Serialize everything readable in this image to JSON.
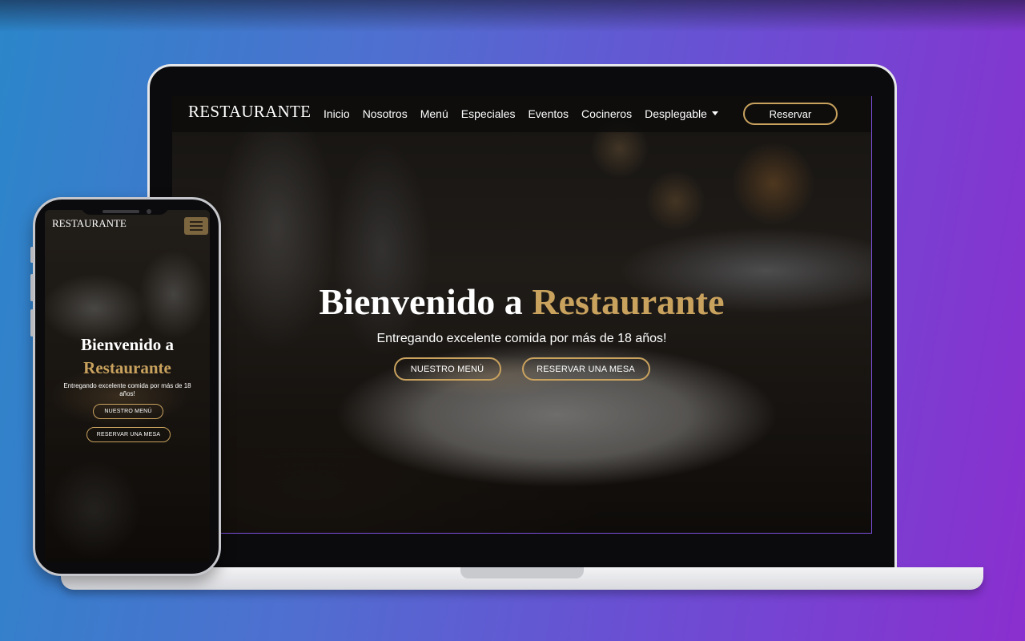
{
  "laptop": {
    "nav": {
      "brand": "RESTAURANTE",
      "links": [
        "Inicio",
        "Nosotros",
        "Menú",
        "Especiales",
        "Eventos",
        "Cocineros",
        "Desplegable"
      ],
      "cta": "Reservar"
    },
    "hero": {
      "title_prefix": "Bienvenido a ",
      "title_accent": "Restaurante",
      "subtitle": "Entregando excelente comida por más de 18 años!",
      "btn_menu": "NUESTRO MENÚ",
      "btn_reserve": "RESERVAR UNA MESA"
    }
  },
  "phone": {
    "brand": "RESTAURANTE",
    "hero": {
      "title_prefix": "Bienvenido a",
      "title_accent": "Restaurante",
      "subtitle": "Entregando excelente comida por más de 18 años!",
      "btn_menu": "NUESTRO MENÚ",
      "btn_reserve": "RESERVAR UNA MESA"
    }
  },
  "colors": {
    "accent": "#c9a25e",
    "nav_bg": "#0c0b0a",
    "background_start": "#2b86c9",
    "background_end": "#8a2fcf"
  },
  "icons": {
    "dropdown": "caret-down-icon",
    "menu_toggle": "hamburger-icon"
  }
}
